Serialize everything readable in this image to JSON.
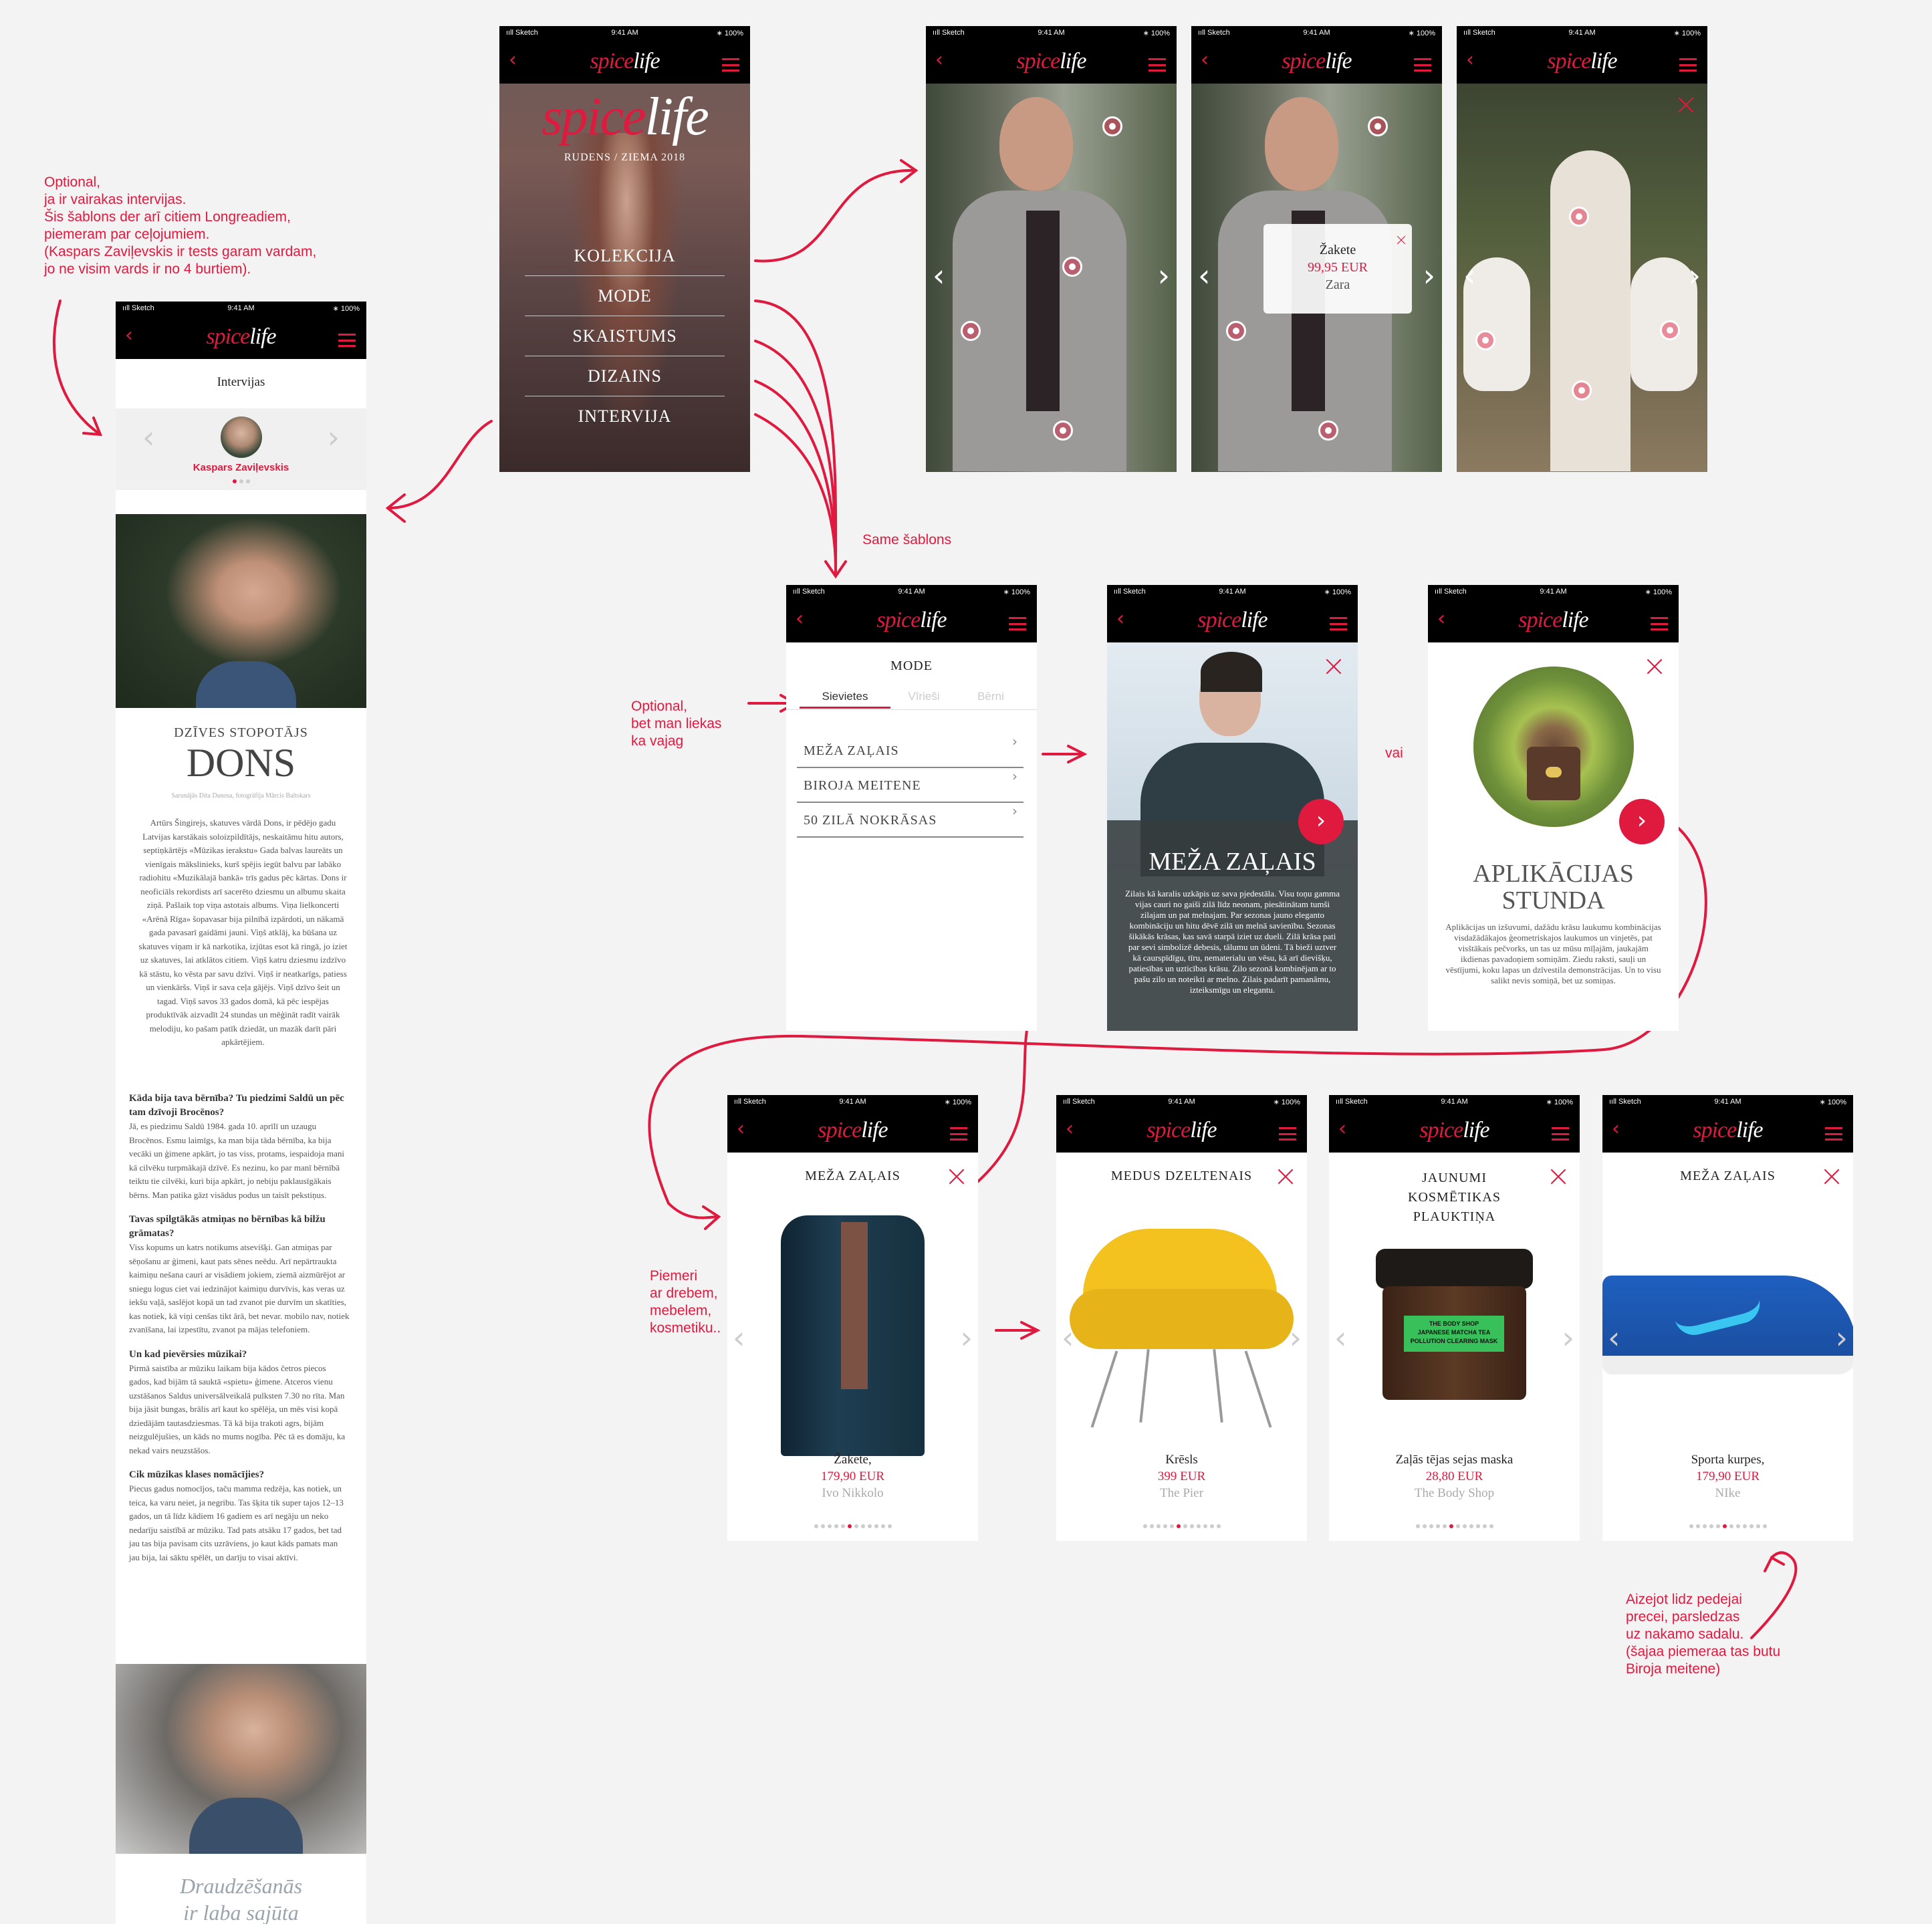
{
  "status_bar": {
    "carrier": "ııll Sketch",
    "time": "9:41 AM",
    "battery": "∗ 100%"
  },
  "brand": {
    "spice": "spice",
    "life": "life",
    "accent_color": "#e0193f"
  },
  "notes": {
    "optional_interviews": "Optional,\nja ir vairakas intervijas.\nŠis šablons der arī citiem Longreadiem,\npiemeram par ceļojumiem.\n(Kaspars Zaviļevskis ir tests garam vardam,\njo ne visim vards ir no 4 burtiem).",
    "same_template": "Same šablons",
    "optional_tabs": "Optional,\nbet man liekas\nka vajag",
    "or": "vai",
    "examples": "Piemeri\nar drebem,\nmebelem,\nkosmetiku..",
    "last_item": "Aizejot lidz pedejai\nprecei, parsledzas\nuz nakamo sadalu.\n(šajaa piemeraa tas butu\nBiroja meitene)"
  },
  "cover": {
    "title_spice": "spice",
    "title_life": "life",
    "season": "RUDENS / ZIEMA 2018",
    "menu": [
      "KOLEKCIJA",
      "MODE",
      "SKAISTUMS",
      "DIZAINS",
      "INTERVIJA"
    ]
  },
  "interview": {
    "header": "Intervijas",
    "person": "Kaspars Zaviļevskis",
    "kicker": "DZĪVES STOPOTĀJS",
    "title": "DONS",
    "byline": "Sarunājās Dita Danosa, fotogrāfija Mārcis Baltskars",
    "intro": "Artūrs Šingirejs, skatuves vārdā Dons, ir pēdējo gadu Latvijas karstākais soloizpildītājs, neskaitāmu hitu autors, septiņkārtējs «Mūzikas ierakstu» Gada balvas laureāts un vienīgais mākslinieks, kurš spējis iegūt balvu par labāko radiohitu «Muzikālajā bankā» trīs gadus pēc kārtas. Dons ir neoficiāls rekordists arī sacerēto dziesmu un albumu skaita ziņā. Pašlaik top viņa astotais albums. Viņa lielkoncerti «Arēnā Rīga» šopavasar bija pilnībā izpārdoti, un nākamā gada pavasarī gaidāmi jauni. Viņš atklāj, ka būšana uz skatuves viņam ir kā narkotika, izjūtas esot kā ringā, jo iziet uz skatuves, lai atklātos citiem. Viņš katru dziesmu izdzīvo kā stāstu, ko vēsta par savu dzīvi. Viņš ir neatkarīgs, patiess un vienkāršs. Viņš ir sava ceļa gājējs. Viņš dzīvo šeit un tagad. Viņš savos 33 gados domā, kā pēc iespējas produktīvāk aizvadīt 24 stundas un mēģināt radīt vairāk melodiju, ko pašam patīk dziedāt, un mazāk darīt pāri apkārtējiem.",
    "qa": [
      {
        "q": "Kāda bija tava bērnība? Tu piedzimi Saldū un pēc tam dzīvoji Brocēnos?",
        "a": "Jā, es piedzimu Saldū 1984. gada 10. aprīlī un uzaugu Brocēnos. Esmu laimīgs, ka man bija tāda bērnība, ka bija vecāki un ģimene apkārt, jo tas viss, protams, iespaidoja mani kā cilvēku turpmākajā dzīvē. Es nezinu, ko par manī bērnībā teiktu tie cilvēki, kuri bija apkārt, jo nebiju paklausīgākais bērns. Man patika gāzt visādus podus un taisīt pekstiņus."
      },
      {
        "q": "Tavas spilgtākās atmiņas no bērnības kā bilžu grāmatas?",
        "a": "Viss kopums un katrs notikums atsevišķi. Gan atmiņas par sēņošanu ar ģimeni, kaut pats sēnes neēdu. Arī nepārtraukta kaimiņu nešana cauri ar visādiem jokiem, ziemā aizmūrējot ar sniegu logus ciet vai iedzinājot kaimiņu durvīvis, kas veras uz iekšu vaļā, saslējot kopā un tad zvanot pie durvīm un skatīties, kas notiek, kā viņi cenšas tikt ārā, bet nevar. mobilo nav, notiek zvanīšana, lai izpestītu, zvanot pa mājas telefoniem."
      },
      {
        "q": "Un kad pievērsies mūzikai?",
        "a": "Pirmā saistība ar mūziku laikam bija kādos četros piecos gados, kad bijām tā sauktā «spietu» ģimene. Atceros vienu uzstāšanos Saldus universālveikalā pulksten 7.30 no rīta. Man bija jāsit bungas, brālis arī kaut ko spēlēja, un mēs visi kopā dziedājām tautasdziesmas. Tā kā bija trakoti agrs, bijām neizgulējušies, un kāds no mums nogība. Pēc tā es domāju, ka nekad vairs neuzstāšos."
      },
      {
        "q": "Cik mūzikas klases nomācījies?",
        "a": "Piecus gadus nomocījos, taču mamma redzēja, kas notiek, un teica, ka varu neiet, ja negribu. Tas šķita tik super tajos 12–13 gados, un tā līdz kādiem 16 gadiem es arī negāju un neko nedarīju saistībā ar mūziku. Tad pats atsāku 17 gados, bet tad jau tas bija pavisam cits uzrāviens, jo kaut kāds pamats man jau bija, lai sāktu spēlēt, un darīju to visai aktīvi."
      }
    ],
    "pullquote": "Draudzēšanās",
    "pullquote2": "ir laba sajūta"
  },
  "gallery": {
    "popup": {
      "name": "Žakete",
      "price": "99,95 EUR",
      "brand": "Zara"
    }
  },
  "mode": {
    "title": "MODE",
    "tabs": [
      "Sievietes",
      "Vīrieši",
      "Bērni"
    ],
    "items": [
      "MEŽA ZAĻAIS",
      "BIROJA MEITENE",
      "50 ZILĀ NOKRĀSAS"
    ]
  },
  "story1": {
    "title": "MEŽA ZAĻAIS",
    "text": "Zilais kā karalis uzkāpis uz sava pjedestāla. Visu toņu gamma vijas cauri no gaiši zilā līdz neonam, piesātinātam tumši zilajam un pat melnajam. Par sezonas jauno eleganto kombināciju un hitu dēvē zilā un melnā savienību. Sezonas šikākās krāsas, kas savā starpā iziet uz dueli. Zilā krāsa pati par sevi simbolizē debesis, tālumu un ūdeni. Tā bieži uztver kā caurspīdīgu, tīru, nematerialu un vēsu, kā arī dievišķu, patiesības un uzticības krāsu. Zilo sezonā kombinējam ar to pašu zilo un noteikti ar melno. Zilais padarīt pamanāmu, izteiksmīgu un elegantu."
  },
  "story2": {
    "title1": "APLIKĀCIJAS",
    "title2": "STUNDA",
    "text": "Aplikācijas un izšuvumi, dažādu krāsu laukumu kombinācijas visdažādākajos ģeometriskajos laukumos un vinjetēs, pat visštākais pečvorks, un tas uz mūsu mīļajām, jaukajām ikdienas pavadoņiem somiņām. Ziedu raksti, sauļi un vēstījumi, koku lapas un dzīvestila demonstrācijas. Un to visu salikt nevis somiņā, bet uz somiņas."
  },
  "products": [
    {
      "title": "MEŽA ZAĻAIS",
      "name": "Žakete,",
      "price": "179,90 EUR",
      "brand": "Ivo Nikkolo",
      "active": 5
    },
    {
      "title": "MEDUS DZELTENAIS",
      "name": "Krēsls",
      "price": "399 EUR",
      "brand": "The Pier",
      "active": 5
    },
    {
      "title": "JAUNUMI\nKOSMĒTIKAS\nPLAUKTIŅA",
      "name": "Zaļās tējas sejas maska",
      "price": "28,80 EUR",
      "brand": "The Body Shop",
      "active": 5,
      "jar_label": "THE BODY SHOP\nJAPANESE MATCHA TEA\nPOLLUTION CLEARING MASK"
    },
    {
      "title": "MEŽA ZAĻAIS",
      "name": "Sporta kurpes,",
      "price": "179,90 EUR",
      "brand": "NIke",
      "active": 5
    }
  ]
}
